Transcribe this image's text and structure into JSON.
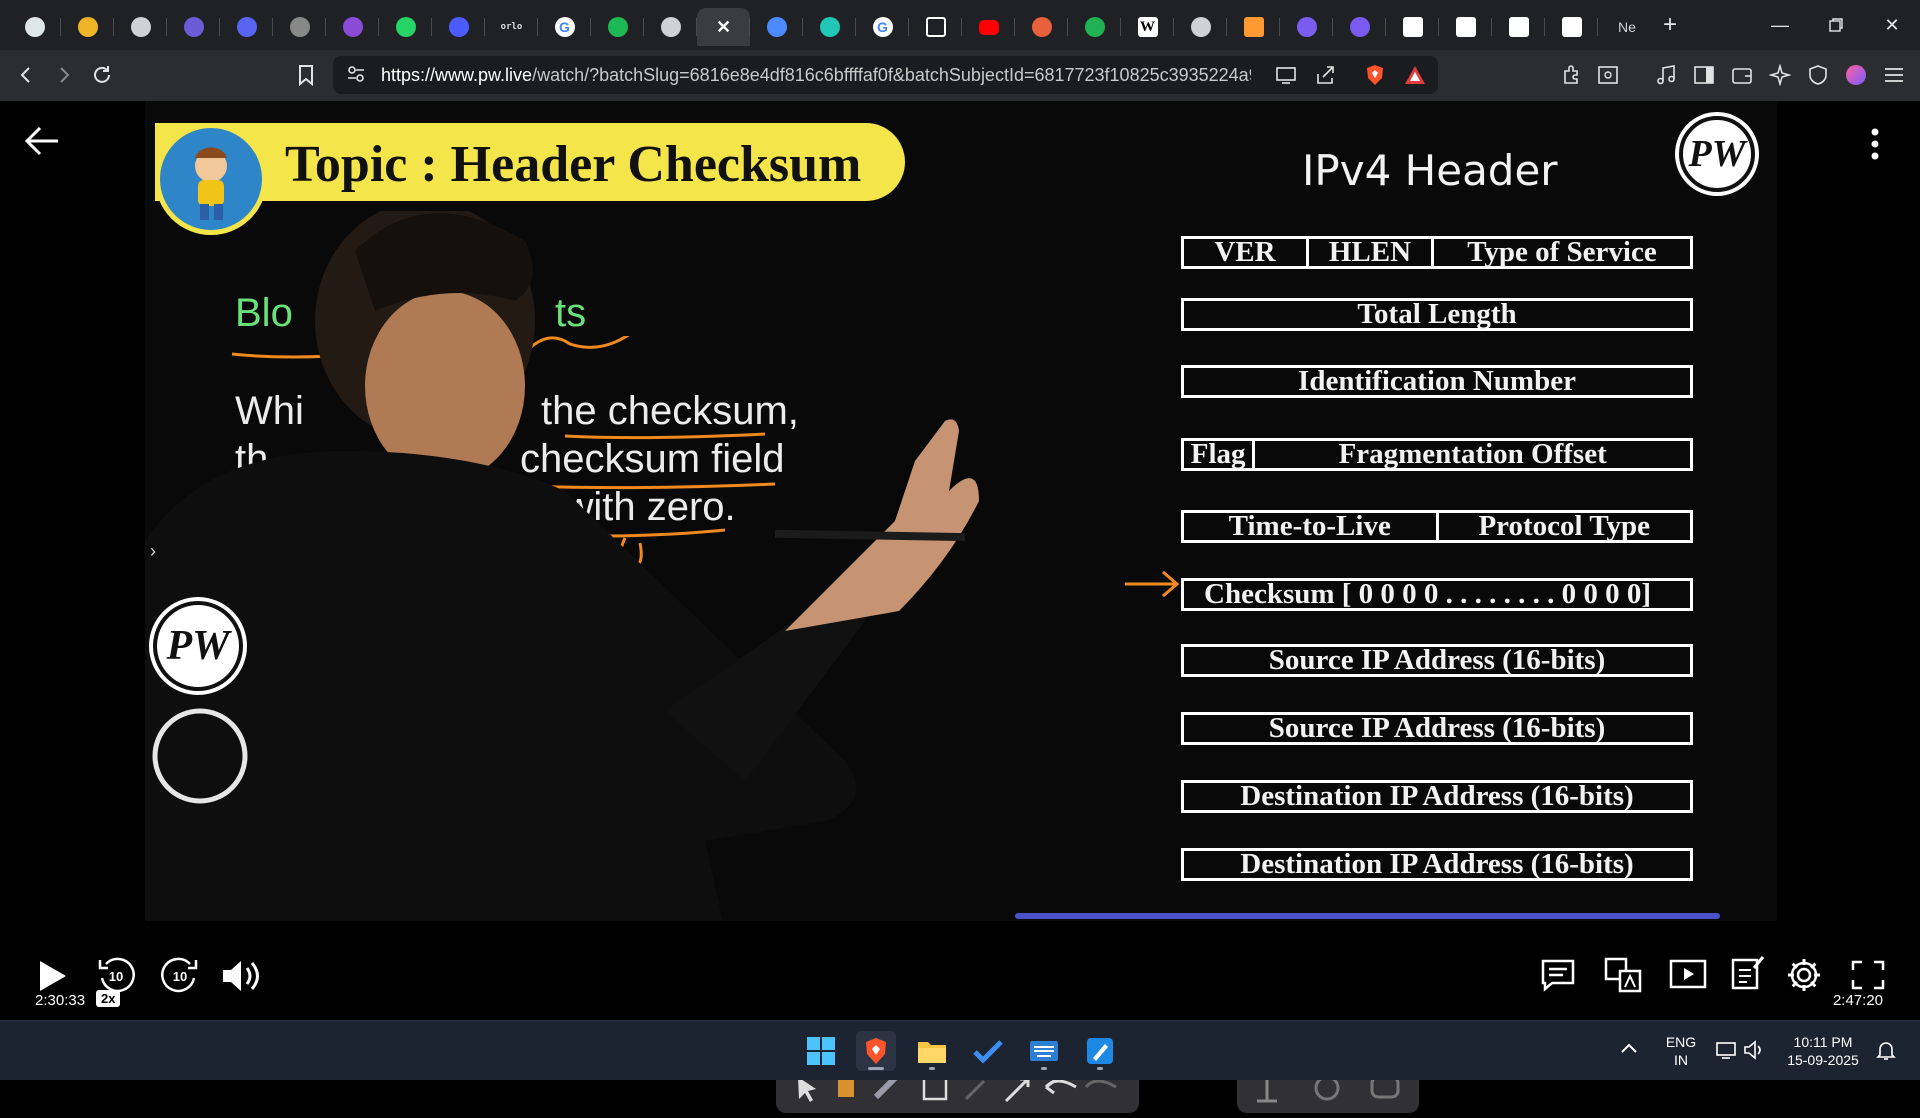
{
  "browser": {
    "tabs": [
      {
        "icon": "chatbot-icon",
        "color": "#dfe6e9"
      },
      {
        "icon": "sync-icon",
        "color": "#f0b429"
      },
      {
        "icon": "globe-icon",
        "color": "#cfd1d4"
      },
      {
        "icon": "app-icon",
        "color": "#6b5bd6"
      },
      {
        "icon": "w3-icon",
        "color": "#5865f2"
      },
      {
        "icon": "grid-icon",
        "color": "#888888"
      },
      {
        "icon": "orbit-icon",
        "color": "#8a4bd6"
      },
      {
        "icon": "whatsapp-icon",
        "color": "#25d366"
      },
      {
        "icon": "bookmark-icon",
        "color": "#4b5bff"
      },
      {
        "icon": "orlo-icon",
        "color": "#dddddd",
        "text": "orlo"
      },
      {
        "icon": "google-icon",
        "color": "#ffffff"
      },
      {
        "icon": "spotify-icon",
        "color": "#1db954"
      },
      {
        "icon": "globe-icon",
        "color": "#cfd1d4"
      },
      {
        "icon": "close-icon",
        "color": "#ffffff",
        "active": true
      },
      {
        "icon": "gemini-icon",
        "color": "#4b8bff"
      },
      {
        "icon": "perplexity-icon",
        "color": "#20c6b6"
      },
      {
        "icon": "google-icon",
        "color": "#ffffff"
      },
      {
        "icon": "window-icon",
        "color": "#ffffff"
      },
      {
        "icon": "youtube-icon",
        "color": "#ff0000"
      },
      {
        "icon": "coin-icon",
        "color": "#e8603c"
      },
      {
        "icon": "w-mark-icon",
        "color": "#1fb152"
      },
      {
        "icon": "wikipedia-icon",
        "color": "#ffffff",
        "text": "W"
      },
      {
        "icon": "globe-icon",
        "color": "#cfd1d4"
      },
      {
        "icon": "india-flag-icon",
        "color": "#ff9933"
      },
      {
        "icon": "lens-icon",
        "color": "#7a5cf0"
      },
      {
        "icon": "lens-icon",
        "color": "#7a5cf0"
      },
      {
        "icon": "notion-icon",
        "color": "#ffffff"
      },
      {
        "icon": "notion-icon",
        "color": "#ffffff"
      },
      {
        "icon": "notion-icon",
        "color": "#ffffff"
      },
      {
        "icon": "notion-icon",
        "color": "#ffffff"
      }
    ],
    "last_tab_label": "Ne",
    "url_domain": "https://www.pw.live",
    "url_rest": "/watch/?batchSlug=6816e8e4df816c6bffffaf0f&batchSubjectId=6817723f10825c3935224a9..."
  },
  "video": {
    "topic": "Topic : Header Checksum",
    "header_title": "IPv4 Header",
    "logo_text": "PW",
    "left_heading_visible": "Blo",
    "left_heading_tail": "ts",
    "left_lines": [
      "Whi",
      "the checksum,",
      "th",
      "checksum field",
      "s",
      "ized with zero."
    ],
    "header_rows": [
      [
        "VER",
        "HLEN",
        "Type of Service"
      ],
      [
        "Total Length"
      ],
      [
        "Identification Number"
      ],
      [
        "Flag",
        "Fragmentation Offset"
      ],
      [
        "Time-to-Live",
        "Protocol Type"
      ],
      [
        "Checksum [ 0 0 0 0 . . . . . . . . 0 0 0 0]"
      ],
      [
        "Source IP Address (16-bits)"
      ],
      [
        "Source IP Address (16-bits)"
      ],
      [
        "Destination IP Address (16-bits)"
      ],
      [
        "Destination IP Address (16-bits)"
      ]
    ]
  },
  "player": {
    "current_time": "2:30:33",
    "speed": "2x",
    "total_time": "2:47:20",
    "progress_fraction": 0.898,
    "rewind_seconds": "10",
    "forward_seconds": "10"
  },
  "taskbar": {
    "language": "ENG",
    "region": "IN",
    "time": "10:11 PM",
    "date": "15-09-2025"
  },
  "colors": {
    "accent": "#8b87ff",
    "topic_banner": "#f4e64a",
    "green_heading": "#69e07a"
  }
}
